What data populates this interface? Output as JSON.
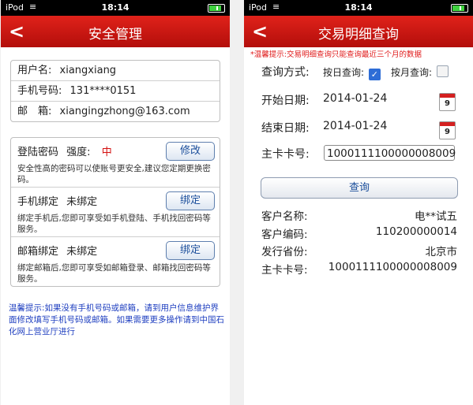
{
  "status_bar": {
    "carrier": "iPod",
    "time": "18:14"
  },
  "left_screen": {
    "title": "安全管理",
    "account": [
      {
        "label": "用户名:",
        "value": "xiangxiang"
      },
      {
        "label": "手机号码:",
        "value": "131****0151"
      },
      {
        "label": "邮　箱:",
        "value": "xiangingzhong@163.com"
      }
    ],
    "password": {
      "label": "登陆密码",
      "strength_label": "强度:",
      "strength_value": "中",
      "button": "修改",
      "desc": "安全性高的密码可以使账号更安全,建议您定期更换密码。"
    },
    "phone_bind": {
      "label": "手机绑定",
      "status": "未绑定",
      "button": "绑定",
      "desc": "绑定手机后,您即可享受如手机登陆、手机找回密码等服务。"
    },
    "email_bind": {
      "label": "邮箱绑定",
      "status": "未绑定",
      "button": "绑定",
      "desc": "绑定邮箱后,您即可享受如邮箱登录、邮箱找回密码等服务。"
    },
    "tip": "温馨提示:如果没有手机号码或邮箱，请到用户信息维护界面修改填写手机号码或邮箱。如果需要更多操作请到中国石化网上营业厅进行"
  },
  "right_screen": {
    "title": "交易明细查询",
    "warning": "*温馨提示:交易明细查询只能查询最近三个月的数据",
    "query_mode_label": "查询方式:",
    "by_day_label": "按日查询:",
    "by_day_checked": true,
    "by_month_label": "按月查询:",
    "by_month_checked": false,
    "start_label": "开始日期:",
    "start_date": "2014-01-24",
    "end_label": "结束日期:",
    "end_date": "2014-01-24",
    "calendar_day": "9",
    "card_label": "主卡卡号:",
    "card_number": "1000111100000008009",
    "query_button": "查询",
    "results": [
      {
        "label": "客户名称:",
        "value": "电**试五"
      },
      {
        "label": "客户编码:",
        "value": "110200000014"
      },
      {
        "label": "发行省份:",
        "value": "北京市"
      },
      {
        "label": "主卡卡号:",
        "value": "1000111100000008009"
      }
    ]
  },
  "colors": {
    "brand_red": "#c8150f",
    "link_blue": "#1b4e9b",
    "tip_blue": "#2040c0",
    "warn_red": "#e01a1a"
  }
}
